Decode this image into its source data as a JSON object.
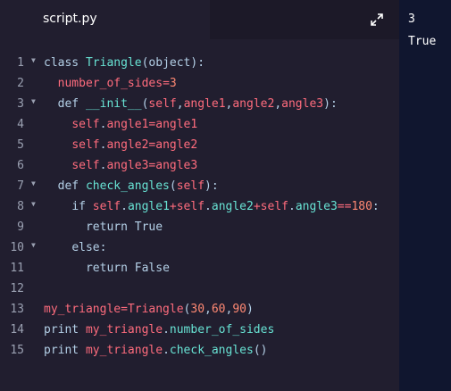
{
  "editor": {
    "tab_label": "script.py",
    "expand_icon": "expand-icon",
    "lines": [
      {
        "n": "1",
        "fold": true,
        "tokens": [
          {
            "t": "class ",
            "c": "kw"
          },
          {
            "t": "Triangle",
            "c": "cyan"
          },
          {
            "t": "(",
            "c": "kw"
          },
          {
            "t": "object",
            "c": "kw"
          },
          {
            "t": "):",
            "c": "kw"
          }
        ]
      },
      {
        "n": "2",
        "fold": false,
        "tokens": [
          {
            "t": "  ",
            "c": ""
          },
          {
            "t": "number_of_sides",
            "c": "red"
          },
          {
            "t": "=",
            "c": "red"
          },
          {
            "t": "3",
            "c": "num"
          }
        ]
      },
      {
        "n": "3",
        "fold": true,
        "tokens": [
          {
            "t": "  ",
            "c": ""
          },
          {
            "t": "def ",
            "c": "kw"
          },
          {
            "t": "__init__",
            "c": "cyan"
          },
          {
            "t": "(",
            "c": "kw"
          },
          {
            "t": "self",
            "c": "red"
          },
          {
            "t": ",",
            "c": "kw"
          },
          {
            "t": "angle1",
            "c": "red"
          },
          {
            "t": ",",
            "c": "kw"
          },
          {
            "t": "angle2",
            "c": "red"
          },
          {
            "t": ",",
            "c": "kw"
          },
          {
            "t": "angle3",
            "c": "red"
          },
          {
            "t": "):",
            "c": "kw"
          }
        ]
      },
      {
        "n": "4",
        "fold": false,
        "tokens": [
          {
            "t": "    ",
            "c": ""
          },
          {
            "t": "self",
            "c": "red"
          },
          {
            "t": ".",
            "c": "kw"
          },
          {
            "t": "angle1",
            "c": "red"
          },
          {
            "t": "=",
            "c": "red"
          },
          {
            "t": "angle1",
            "c": "red"
          }
        ]
      },
      {
        "n": "5",
        "fold": false,
        "tokens": [
          {
            "t": "    ",
            "c": ""
          },
          {
            "t": "self",
            "c": "red"
          },
          {
            "t": ".",
            "c": "kw"
          },
          {
            "t": "angle2",
            "c": "red"
          },
          {
            "t": "=",
            "c": "red"
          },
          {
            "t": "angle2",
            "c": "red"
          }
        ]
      },
      {
        "n": "6",
        "fold": false,
        "tokens": [
          {
            "t": "    ",
            "c": ""
          },
          {
            "t": "self",
            "c": "red"
          },
          {
            "t": ".",
            "c": "kw"
          },
          {
            "t": "angle3",
            "c": "red"
          },
          {
            "t": "=",
            "c": "red"
          },
          {
            "t": "angle3",
            "c": "red"
          }
        ]
      },
      {
        "n": "7",
        "fold": true,
        "tokens": [
          {
            "t": "  ",
            "c": ""
          },
          {
            "t": "def ",
            "c": "kw"
          },
          {
            "t": "check_angles",
            "c": "cyan"
          },
          {
            "t": "(",
            "c": "kw"
          },
          {
            "t": "self",
            "c": "red"
          },
          {
            "t": "):",
            "c": "kw"
          }
        ]
      },
      {
        "n": "8",
        "fold": true,
        "tokens": [
          {
            "t": "    ",
            "c": ""
          },
          {
            "t": "if ",
            "c": "kw"
          },
          {
            "t": "self",
            "c": "red"
          },
          {
            "t": ".",
            "c": "kw"
          },
          {
            "t": "angle1",
            "c": "cyan"
          },
          {
            "t": "+",
            "c": "red"
          },
          {
            "t": "self",
            "c": "red"
          },
          {
            "t": ".",
            "c": "kw"
          },
          {
            "t": "angle2",
            "c": "cyan"
          },
          {
            "t": "+",
            "c": "red"
          },
          {
            "t": "self",
            "c": "red"
          },
          {
            "t": ".",
            "c": "kw"
          },
          {
            "t": "angle3",
            "c": "cyan"
          },
          {
            "t": "==",
            "c": "red"
          },
          {
            "t": "180",
            "c": "num"
          },
          {
            "t": ":",
            "c": "kw"
          }
        ]
      },
      {
        "n": "9",
        "fold": false,
        "tokens": [
          {
            "t": "      ",
            "c": ""
          },
          {
            "t": "return ",
            "c": "kw"
          },
          {
            "t": "True",
            "c": "kw"
          }
        ]
      },
      {
        "n": "10",
        "fold": true,
        "tokens": [
          {
            "t": "    ",
            "c": ""
          },
          {
            "t": "else",
            "c": "kw"
          },
          {
            "t": ":",
            "c": "kw"
          }
        ]
      },
      {
        "n": "11",
        "fold": false,
        "tokens": [
          {
            "t": "      ",
            "c": ""
          },
          {
            "t": "return ",
            "c": "kw"
          },
          {
            "t": "False",
            "c": "kw"
          }
        ]
      },
      {
        "n": "12",
        "fold": false,
        "tokens": []
      },
      {
        "n": "13",
        "fold": false,
        "tokens": [
          {
            "t": "my_triangle",
            "c": "red"
          },
          {
            "t": "=",
            "c": "red"
          },
          {
            "t": "Triangle",
            "c": "red"
          },
          {
            "t": "(",
            "c": "kw"
          },
          {
            "t": "30",
            "c": "num"
          },
          {
            "t": ",",
            "c": "kw"
          },
          {
            "t": "60",
            "c": "num"
          },
          {
            "t": ",",
            "c": "kw"
          },
          {
            "t": "90",
            "c": "num"
          },
          {
            "t": ")",
            "c": "kw"
          }
        ]
      },
      {
        "n": "14",
        "fold": false,
        "tokens": [
          {
            "t": "print ",
            "c": "kw"
          },
          {
            "t": "my_triangle",
            "c": "red"
          },
          {
            "t": ".",
            "c": "kw"
          },
          {
            "t": "number_of_sides",
            "c": "cyan"
          }
        ]
      },
      {
        "n": "15",
        "fold": false,
        "tokens": [
          {
            "t": "print ",
            "c": "kw"
          },
          {
            "t": "my_triangle",
            "c": "red"
          },
          {
            "t": ".",
            "c": "kw"
          },
          {
            "t": "check_angles",
            "c": "cyan"
          },
          {
            "t": "()",
            "c": "kw"
          }
        ]
      }
    ]
  },
  "output": {
    "lines": [
      "3",
      "True"
    ]
  }
}
